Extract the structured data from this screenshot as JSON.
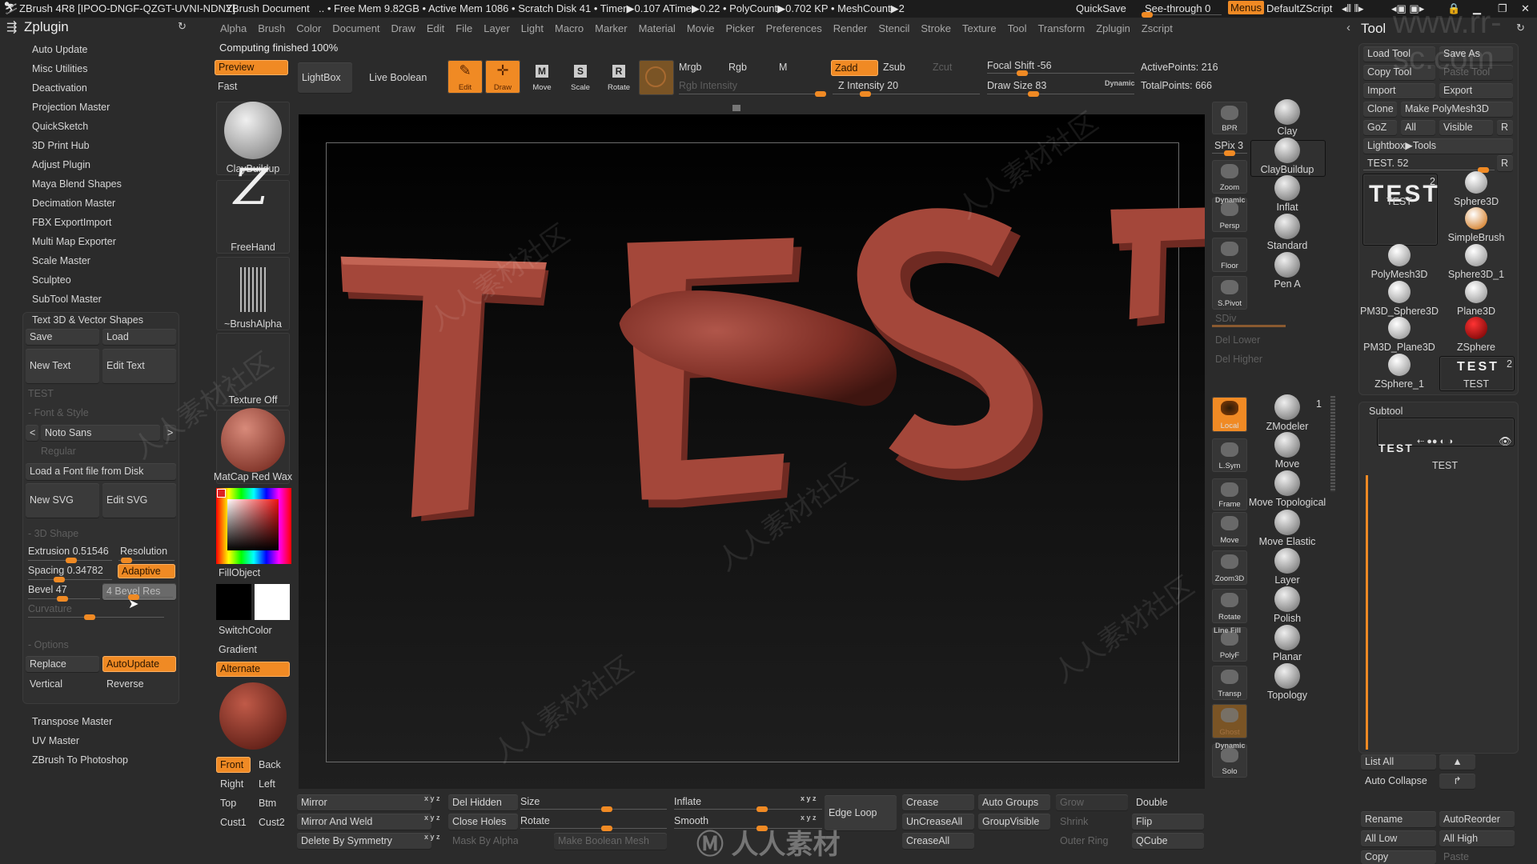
{
  "colors": {
    "accent": "#f08a24",
    "panel": "#303030",
    "background": "#2b2b2b",
    "model": "#a4473a"
  },
  "title_bar": {
    "app_title": "ZBrush 4R8 [IPOO-DNGF-QZGT-UVNI-NDNY]",
    "document": "ZBrush Document",
    "status": ".. • Free Mem 9.82GB • Active Mem 1086 • Scratch Disk 41 • Timer▶0.107 ATime▶0.22 • PolyCount▶0.702 KP • MeshCount▶2",
    "quicksave": "QuickSave",
    "see_through": "See-through  0",
    "menus": "Menus",
    "default_zscript": "DefaultZScript"
  },
  "menu_bar": {
    "items": [
      "Alpha",
      "Brush",
      "Color",
      "Document",
      "Draw",
      "Edit",
      "File",
      "Layer",
      "Light",
      "Macro",
      "Marker",
      "Material",
      "Movie",
      "Picker",
      "Preferences",
      "Render",
      "Stencil",
      "Stroke",
      "Texture",
      "Tool",
      "Transform",
      "Zplugin",
      "Zscript"
    ]
  },
  "status_message": "Computing finished 100%",
  "top_shelf": {
    "preview": "Preview",
    "fast": "Fast",
    "lightbox": "LightBox",
    "live_boolean": "Live Boolean",
    "edit": "Edit",
    "draw": "Draw",
    "move": "Move",
    "scale": "Scale",
    "rotate": "Rotate",
    "mrgb": "Mrgb",
    "rgb": "Rgb",
    "m": "M",
    "zadd": "Zadd",
    "zsub": "Zsub",
    "zcut": "Zcut",
    "rgb_intensity": "Rgb Intensity",
    "z_intensity": "Z Intensity 20",
    "focal_shift": "Focal Shift -56",
    "draw_size": "Draw Size 83",
    "dynamic": "Dynamic",
    "active_points": "ActivePoints: 216",
    "total_points": "TotalPoints: 666"
  },
  "slider_levels": {
    "see_through": 0.0,
    "rgb_intensity": 1.0,
    "z_intensity": 0.2,
    "focal_shift": 0.22,
    "draw_size": 0.3,
    "extrusion": 0.52,
    "resolution": 0.05,
    "spacing": 0.35,
    "bevel": 0.47,
    "bevel_res": 0.4,
    "curvature": 0.45,
    "spix": 0.5,
    "tool_slider": 0.95,
    "size": 0.6,
    "rotate": 0.6,
    "inflate": 0.6,
    "smooth": 0.6
  },
  "zplugin": {
    "title": "Zplugin",
    "items_top": [
      "Auto Update",
      "Misc Utilities",
      "Deactivation",
      "Projection Master",
      "QuickSketch",
      "3D Print Hub",
      "Adjust Plugin",
      "Maya Blend Shapes",
      "Decimation Master",
      "FBX ExportImport",
      "Multi Map Exporter",
      "Scale Master",
      "Sculpteo",
      "SubTool Master"
    ],
    "text3d": {
      "title": "Text 3D & Vector Shapes",
      "save": "Save",
      "load": "Load",
      "new_text": "New Text",
      "edit_text": "Edit Text",
      "text_value": "TEST",
      "font_style": "- Font & Style",
      "prev": "< |",
      "font": "Noto Sans",
      "next": "> |",
      "style": "Regular",
      "load_font": "Load a Font file from Disk",
      "new_svg": "New SVG",
      "edit_svg": "Edit SVG",
      "shape_section": "- 3D Shape",
      "extrusion": "Extrusion 0.51546",
      "resolution": "Resolution",
      "spacing": "Spacing 0.34782",
      "adaptive": "Adaptive",
      "bevel": "Bevel 47",
      "bevel_res": "4 Bevel Res",
      "curvature": "Curvature",
      "options": "- Options",
      "replace": "Replace",
      "autoupdate": "AutoUpdate",
      "vertical": "Vertical",
      "reverse": "Reverse"
    },
    "items_bottom": [
      "Transpose Master",
      "UV Master",
      "ZBrush To Photoshop"
    ]
  },
  "left_tray": {
    "brush": "ClayBuildup",
    "stroke": "FreeHand",
    "alpha": "~BrushAlpha",
    "texture": "Texture Off",
    "material": "MatCap Red Wax",
    "fill_object": "FillObject",
    "switch_color": "SwitchColor",
    "gradient": "Gradient",
    "alternate": "Alternate",
    "front": "Front",
    "back": "Back",
    "right": "Right",
    "left": "Left",
    "top": "Top",
    "btm": "Btm",
    "cust1": "Cust1",
    "cust2": "Cust2"
  },
  "right_shelf": {
    "bpr": "BPR",
    "spix": "SPix 3",
    "zoom": "Zoom",
    "dynamic": "Dynamic",
    "persp": "Persp",
    "floor": "Floor",
    "spivot": "S.Pivot",
    "sdiv": "SDiv",
    "del_lower": "Del Lower",
    "del_higher": "Del Higher",
    "local": "Local",
    "lsym": "L.Sym",
    "frame": "Frame",
    "move": "Move",
    "zoom3d": "Zoom3D",
    "rotate": "Rotate",
    "line_fill": "Line Fill",
    "polyf": "PolyF",
    "transp": "Transp",
    "ghost": "Ghost",
    "solo_dynamic": "Dynamic",
    "solo": "Solo"
  },
  "brush_palette": {
    "items": [
      "Clay",
      "ClayBuildup",
      "Inflat",
      "Standard",
      "Pen A",
      "ZModeler",
      "Move",
      "Move Topological",
      "Move Elastic",
      "Layer",
      "Polish",
      "Planar",
      "Topology"
    ],
    "selected": "ClayBuildup",
    "zmodeler_badge": "1"
  },
  "tool_panel": {
    "title": "Tool",
    "load_tool": "Load Tool",
    "save_as": "Save As",
    "copy_tool": "Copy Tool",
    "paste_tool": "Paste Tool",
    "import": "Import",
    "export": "Export",
    "clone": "Clone",
    "make_polymesh": "Make PolyMesh3D",
    "goz": "GoZ",
    "all": "All",
    "visible": "Visible",
    "r": "R",
    "lightbox_tools": "Lightbox▶Tools",
    "tool_slider": "TEST. 52",
    "tools": [
      {
        "name": "TEST",
        "badge": "2"
      },
      {
        "name": "Sphere3D"
      },
      {
        "name": "SimpleBrush"
      },
      {
        "name": "PolyMesh3D"
      },
      {
        "name": "Sphere3D_1"
      },
      {
        "name": "PM3D_Sphere3D"
      },
      {
        "name": "Plane3D"
      },
      {
        "name": "PM3D_Plane3D"
      },
      {
        "name": "ZSphere"
      },
      {
        "name": "ZSphere_1"
      },
      {
        "name": "TEST",
        "badge": "2"
      }
    ],
    "subtool": {
      "title": "Subtool",
      "item": "TEST",
      "thumb": "TEST"
    },
    "list_all": "List All",
    "auto_collapse": "Auto Collapse",
    "rename": "Rename",
    "autoreorder": "AutoReorder",
    "all_low": "All Low",
    "all_high": "All High",
    "copy": "Copy",
    "paste": "Paste"
  },
  "bottom": {
    "mirror": "Mirror",
    "mirror_weld": "Mirror And Weld",
    "delete_sym": "Delete By Symmetry",
    "xyz": "x y z",
    "del_hidden": "Del Hidden",
    "close_holes": "Close Holes",
    "mask_alpha": "Mask By Alpha",
    "size": "Size",
    "rotate": "Rotate",
    "make_boolean": "Make Boolean Mesh",
    "inflate": "Inflate",
    "smooth": "Smooth",
    "edge_loop": "Edge Loop",
    "crease": "Crease",
    "uncrease_all": "UnCreaseAll",
    "crease_all": "CreaseAll",
    "auto_groups": "Auto Groups",
    "group_visible": "GroupVisible",
    "grow": "Grow",
    "shrink": "Shrink",
    "outer_ring": "Outer Ring",
    "double": "Double",
    "flip": "Flip",
    "qcube": "QCube"
  },
  "canvas_model": {
    "text": "TEST"
  },
  "watermarks": [
    "人人素材社区",
    "www.rr-sc.com",
    "人人素材"
  ]
}
